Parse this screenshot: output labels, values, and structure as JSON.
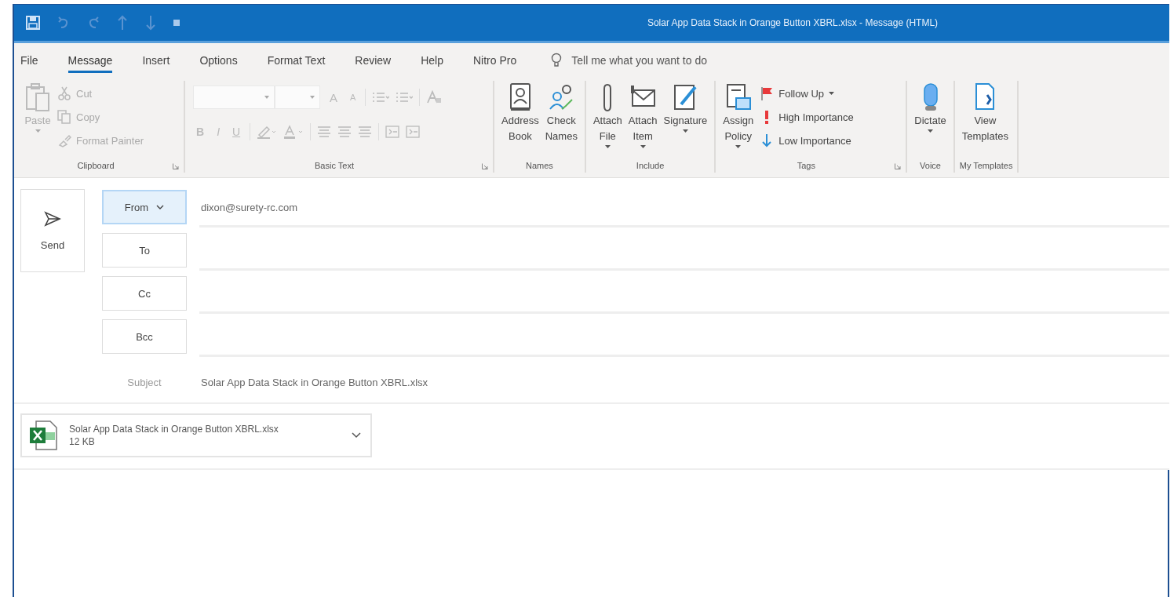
{
  "window": {
    "title": "Solar App Data Stack in Orange Button XBRL.xlsx  -  Message (HTML)"
  },
  "tabs": [
    {
      "label": "File",
      "selected": false
    },
    {
      "label": "Message",
      "selected": true
    },
    {
      "label": "Insert",
      "selected": false
    },
    {
      "label": "Options",
      "selected": false
    },
    {
      "label": "Format Text",
      "selected": false
    },
    {
      "label": "Review",
      "selected": false
    },
    {
      "label": "Help",
      "selected": false
    },
    {
      "label": "Nitro Pro",
      "selected": false
    }
  ],
  "tell_me": {
    "placeholder": "Tell me what you want to do"
  },
  "ribbon": {
    "groups": [
      {
        "name": "Clipboard",
        "kind": "clipboard",
        "disabled": true,
        "launcher": true,
        "items": [
          {
            "lines": [
              "Paste"
            ],
            "kind": "large",
            "menu": true
          },
          {
            "lines": [
              "Cut"
            ],
            "kind": "small",
            "menu": false
          },
          {
            "lines": [
              "Copy"
            ],
            "kind": "small",
            "menu": false
          },
          {
            "lines": [
              "Format Painter"
            ],
            "kind": "small",
            "menu": false
          }
        ]
      },
      {
        "name": "Basic Text",
        "kind": "text",
        "disabled": true,
        "launcher": true,
        "row1": [
          {
            "label": "A",
            "kind": "grow"
          },
          {
            "label": "A",
            "kind": "shrink"
          }
        ],
        "row2": [
          {
            "label": "B",
            "kind": "bold"
          },
          {
            "label": "I",
            "kind": "italic"
          },
          {
            "label": "U",
            "kind": "underline"
          }
        ]
      },
      {
        "name": "Names",
        "kind": "buttons",
        "disabled": false,
        "launcher": false,
        "items": [
          {
            "lines": [
              "Address",
              "Book"
            ],
            "kind": "large",
            "menu": false
          },
          {
            "lines": [
              "Check",
              "Names"
            ],
            "kind": "large",
            "menu": false
          }
        ]
      },
      {
        "name": "Include",
        "kind": "buttons",
        "disabled": false,
        "launcher": false,
        "items": [
          {
            "lines": [
              "Attach",
              "File"
            ],
            "kind": "large",
            "menu": true
          },
          {
            "lines": [
              "Attach",
              "Item"
            ],
            "kind": "large",
            "menu": true
          },
          {
            "lines": [
              "Signature"
            ],
            "kind": "large",
            "menu": true
          }
        ]
      },
      {
        "name": "Tags",
        "kind": "tags",
        "disabled": false,
        "launcher": true,
        "items": [
          {
            "lines": [
              "Assign",
              "Policy"
            ],
            "kind": "large",
            "menu": true
          },
          {
            "lines": [
              "Follow Up"
            ],
            "kind": "small",
            "menu": true
          },
          {
            "lines": [
              "High Importance"
            ],
            "kind": "small",
            "menu": false
          },
          {
            "lines": [
              "Low Importance"
            ],
            "kind": "small",
            "menu": false
          }
        ]
      },
      {
        "name": "Voice",
        "kind": "buttons",
        "disabled": false,
        "launcher": false,
        "items": [
          {
            "lines": [
              "Dictate"
            ],
            "kind": "large",
            "menu": true
          }
        ]
      },
      {
        "name": "My Templates",
        "kind": "buttons",
        "disabled": false,
        "launcher": false,
        "items": [
          {
            "lines": [
              "View",
              "Templates"
            ],
            "kind": "large",
            "menu": false
          }
        ]
      }
    ]
  },
  "compose": {
    "send": "Send",
    "fields": [
      {
        "label": "From",
        "kind": "dropdown",
        "value": "dixon@surety-rc.com"
      },
      {
        "label": "To",
        "kind": "button"
      },
      {
        "label": "Cc",
        "kind": "button"
      },
      {
        "label": "Bcc",
        "kind": "button"
      },
      {
        "label": "Subject",
        "kind": "label",
        "value": "Solar App Data Stack in Orange Button XBRL.xlsx"
      }
    ],
    "attachment": {
      "name": "Solar App Data Stack in Orange Button XBRL.xlsx",
      "size": "12 KB"
    }
  }
}
